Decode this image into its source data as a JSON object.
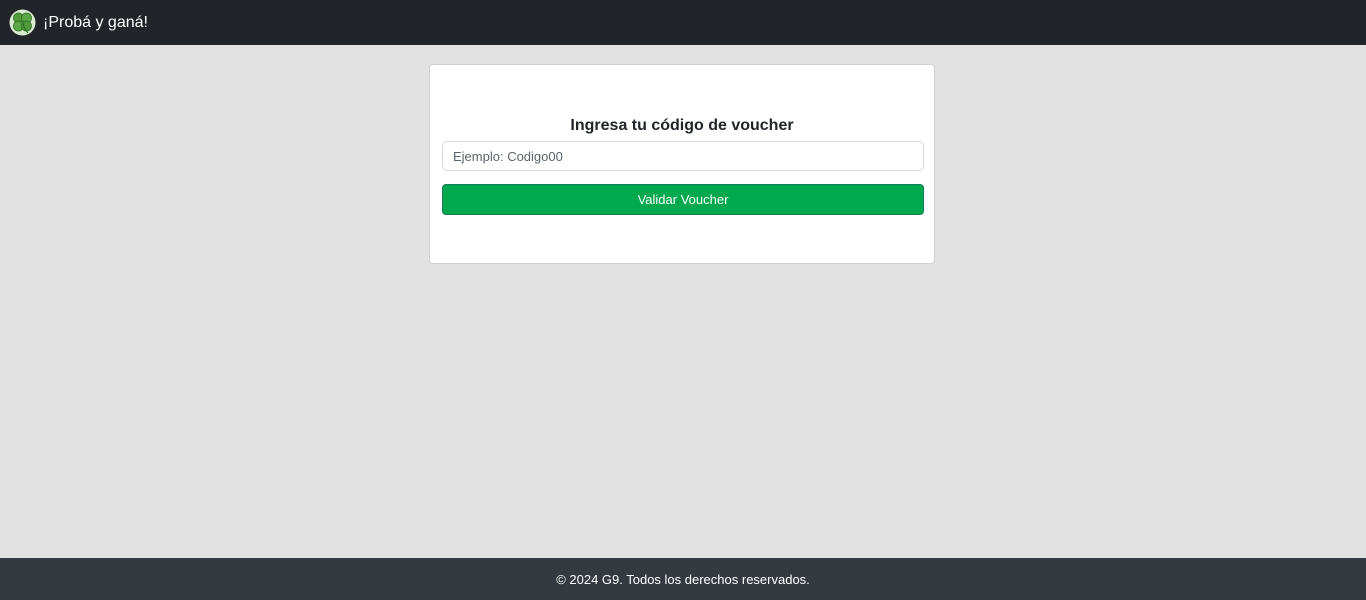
{
  "navbar": {
    "brand_text": "¡Probá y ganá!",
    "logo_icon": "four-leaf-clover-icon",
    "background": "#212529"
  },
  "card": {
    "title": "Ingresa tu código de voucher",
    "input": {
      "value": "",
      "placeholder": "Ejemplo: Codigo00"
    },
    "button_label": "Validar Voucher",
    "button_color": "#00a94e"
  },
  "footer": {
    "text": "© 2024 G9. Todos los derechos reservados.",
    "background": "#343a40"
  },
  "page": {
    "background": "#e2e2e2"
  }
}
